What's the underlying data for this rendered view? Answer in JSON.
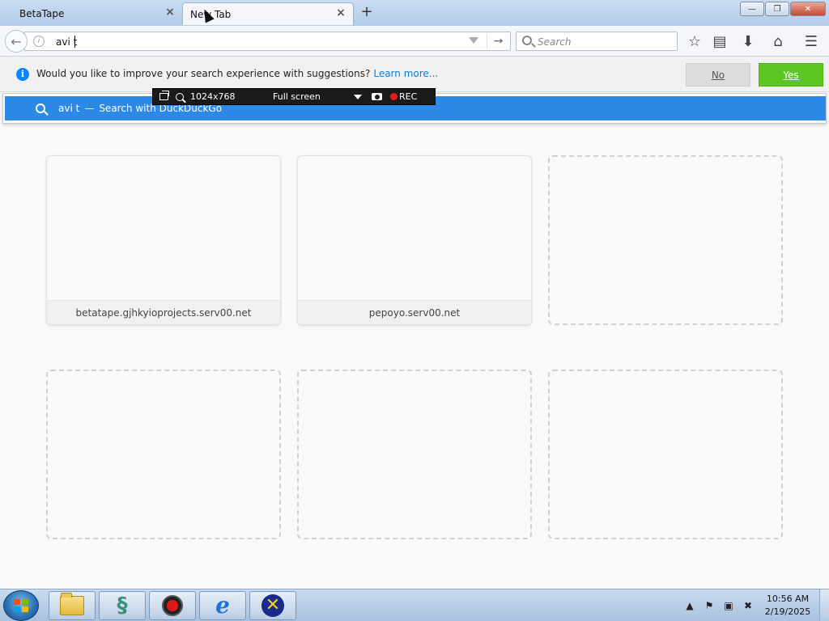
{
  "browser": {
    "tabs": [
      {
        "label": "BetaTape",
        "close": "×"
      },
      {
        "label": "New Tab",
        "close": "×"
      }
    ],
    "new_tab": "+",
    "window_controls": {
      "minimize": "—",
      "restore": "❐",
      "close": "✕"
    },
    "urlbar": {
      "value": "avi t",
      "go": "→"
    },
    "searchbar": {
      "placeholder": "Search"
    },
    "toolbar_icons": [
      "star-icon",
      "reading-list-icon",
      "download-icon",
      "home-icon",
      "menu-icon"
    ]
  },
  "notification": {
    "message": "Would you like to improve your search experience with suggestions?",
    "link": "Learn more...",
    "no_label": "No",
    "yes_label": "Yes",
    "yes_color": "#5cc722"
  },
  "autocomplete": {
    "term": "avi t",
    "separator": "—",
    "action": "Search with DuckDuckGo",
    "highlight_color": "#2d89e6"
  },
  "recorder": {
    "resolution": "1024x768",
    "mode": "Full screen",
    "rec_label": "REC"
  },
  "tiles": [
    {
      "label": "betatape.gjhkyioprojects.serv00.net",
      "filled": true
    },
    {
      "label": "pepoyo.serv00.net",
      "filled": true
    },
    {
      "label": "",
      "filled": false
    },
    {
      "label": "",
      "filled": false
    },
    {
      "label": "",
      "filled": false
    },
    {
      "label": "",
      "filled": false
    }
  ],
  "taskbar": {
    "apps": [
      "file-explorer-icon",
      "dragon-icon",
      "record-icon",
      "internet-explorer-icon",
      "x-app-icon"
    ],
    "time": "10:56 AM",
    "date": "2/19/2025"
  }
}
